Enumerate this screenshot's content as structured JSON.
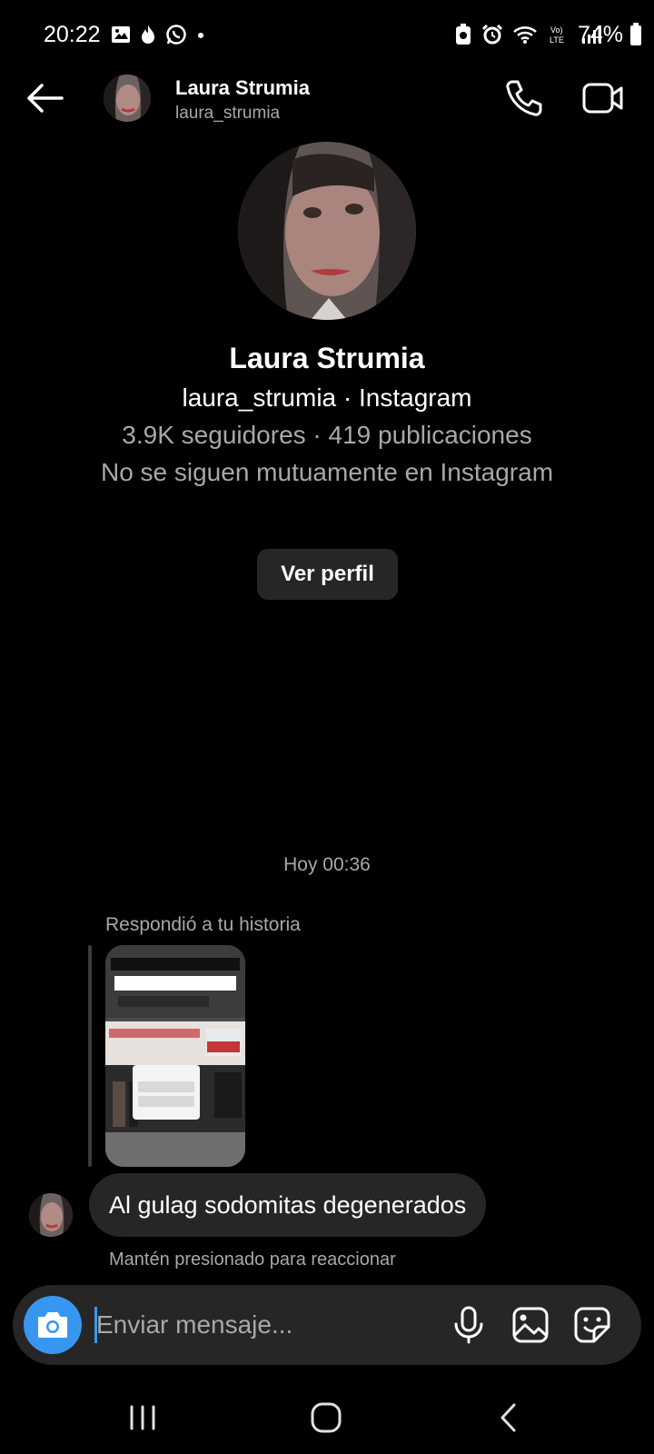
{
  "status_bar": {
    "time": "20:22",
    "battery": "74%",
    "left_icons": [
      "image-icon",
      "fire-icon",
      "whatsapp-icon",
      "dot-icon"
    ],
    "right_icons": [
      "battery-saver-icon",
      "alarm-icon",
      "wifi-icon",
      "volte-icon",
      "signal-icon"
    ]
  },
  "header": {
    "name": "Laura Strumia",
    "handle": "laura_strumia"
  },
  "profile": {
    "name": "Laura Strumia",
    "subtitle": "laura_strumia · Instagram",
    "stats": "3.9K seguidores · 419 publicaciones",
    "mutual": "No se siguen mutuamente en Instagram",
    "view_button": "Ver perfil"
  },
  "chat": {
    "timestamp": "Hoy 00:36",
    "reply_label": "Respondió a tu historia",
    "message": "Al gulag sodomitas degenerados",
    "react_hint": "Mantén presionado para reaccionar"
  },
  "composer": {
    "placeholder": "Enviar mensaje..."
  },
  "colors": {
    "background": "#000000",
    "bubble": "#262626",
    "accent": "#3797f0",
    "secondary_text": "#a8a8a8"
  }
}
